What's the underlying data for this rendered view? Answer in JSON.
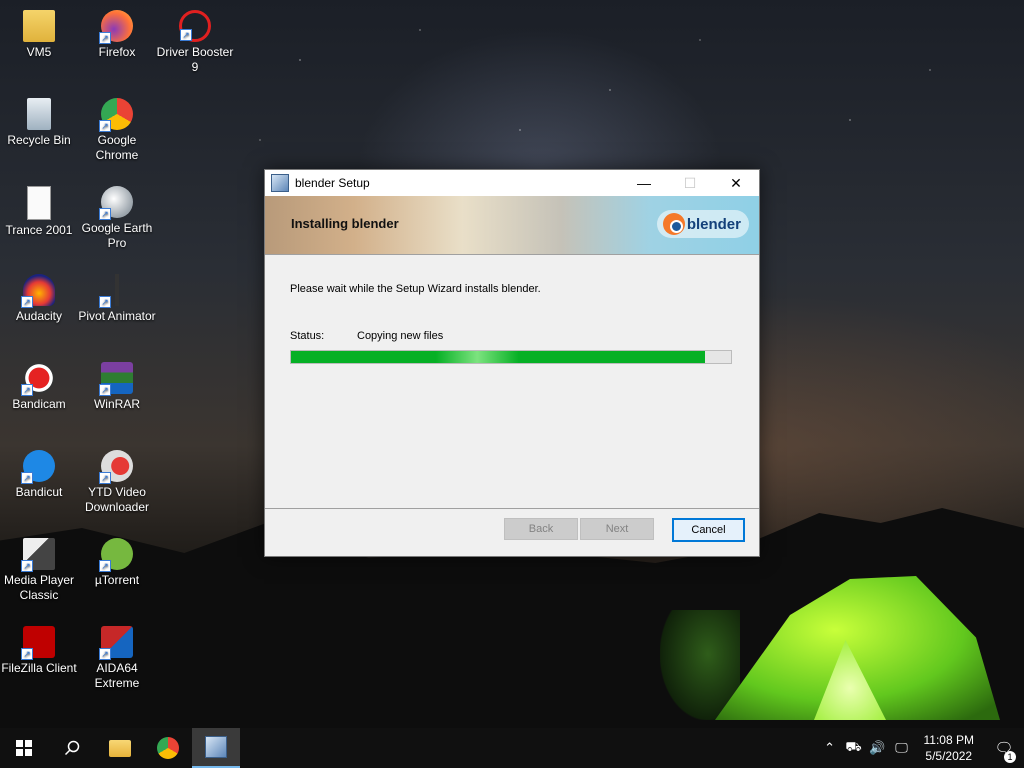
{
  "desktop": {
    "icons": [
      {
        "label": "VM5",
        "icon": "folder-user-icon"
      },
      {
        "label": "Firefox",
        "icon": "firefox-icon"
      },
      {
        "label": "Driver Booster 9",
        "icon": "driver-booster-icon"
      },
      {
        "label": "Recycle Bin",
        "icon": "recycle-bin-icon"
      },
      {
        "label": "Google Chrome",
        "icon": "chrome-icon"
      },
      {
        "label": "Trance 2001",
        "icon": "document-icon"
      },
      {
        "label": "Google Earth Pro",
        "icon": "google-earth-icon"
      },
      {
        "label": "Audacity",
        "icon": "audacity-icon"
      },
      {
        "label": "Pivot Animator",
        "icon": "pivot-icon"
      },
      {
        "label": "Bandicam",
        "icon": "bandicam-icon"
      },
      {
        "label": "WinRAR",
        "icon": "winrar-icon"
      },
      {
        "label": "Bandicut",
        "icon": "bandicut-icon"
      },
      {
        "label": "YTD Video Downloader",
        "icon": "ytd-icon"
      },
      {
        "label": "Media Player Classic",
        "icon": "mpc-icon"
      },
      {
        "label": "µTorrent",
        "icon": "utorrent-icon"
      },
      {
        "label": "FileZilla Client",
        "icon": "filezilla-icon"
      },
      {
        "label": "AIDA64 Extreme",
        "icon": "aida64-icon"
      }
    ]
  },
  "dialog": {
    "title": "blender Setup",
    "heading": "Installing blender",
    "logo_text": "blender",
    "message": "Please wait while the Setup Wizard installs blender.",
    "status_label": "Status:",
    "status_value": "Copying new files",
    "progress": 0.94,
    "buttons": {
      "back": "Back",
      "next": "Next",
      "cancel": "Cancel"
    },
    "controls": {
      "minimize": "—",
      "maximize": "☐",
      "close": "✕"
    }
  },
  "taskbar": {
    "clock_time": "11:08 PM",
    "clock_date": "5/5/2022",
    "notification_count": "1",
    "pinned": [
      "file-explorer-icon",
      "chrome-icon",
      "setup-installer-icon"
    ]
  },
  "colors": {
    "progress_fill": "#06b025",
    "accent": "#0078d7",
    "blender_orange": "#f5792a"
  }
}
